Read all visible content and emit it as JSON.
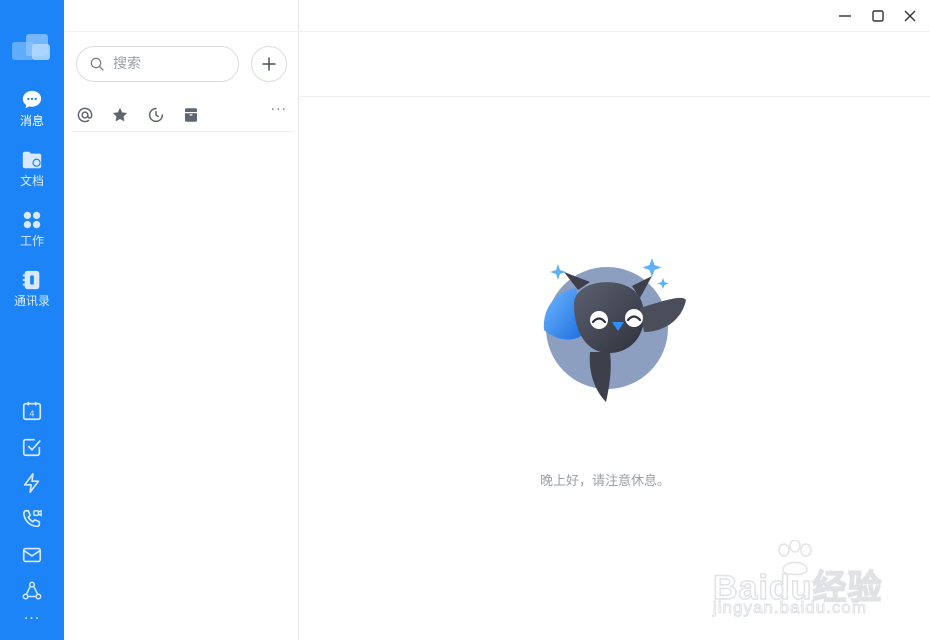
{
  "colors": {
    "rail": "#1c84f6",
    "accent": "#1c84f6",
    "muted": "#9aa0a6"
  },
  "nav": {
    "items": [
      {
        "label": "消息",
        "icon": "chat-bubble-icon",
        "active": true
      },
      {
        "label": "文档",
        "icon": "folder-doc-icon",
        "active": false
      },
      {
        "label": "工作",
        "icon": "grid-apps-icon",
        "active": false
      },
      {
        "label": "通讯录",
        "icon": "contacts-book-icon",
        "active": false
      }
    ],
    "tools": [
      {
        "icon": "calendar-icon",
        "day": "4"
      },
      {
        "icon": "checkbox-icon"
      },
      {
        "icon": "lightning-icon"
      },
      {
        "icon": "video-call-icon"
      },
      {
        "icon": "mail-icon"
      },
      {
        "icon": "network-icon"
      },
      {
        "icon": "more-icon",
        "label": "···"
      }
    ]
  },
  "search": {
    "placeholder": "搜索"
  },
  "filters": {
    "items": [
      {
        "icon": "at-icon"
      },
      {
        "icon": "star-icon"
      },
      {
        "icon": "clock-icon"
      },
      {
        "icon": "archive-icon"
      }
    ],
    "more_label": "···"
  },
  "window": {
    "controls": [
      "minimize-icon",
      "maximize-icon",
      "close-icon"
    ]
  },
  "main": {
    "greeting": "晚上好，请注意休息。"
  },
  "watermark": {
    "main": "Baidu经验",
    "sub": "jingyan.baidu.com"
  }
}
